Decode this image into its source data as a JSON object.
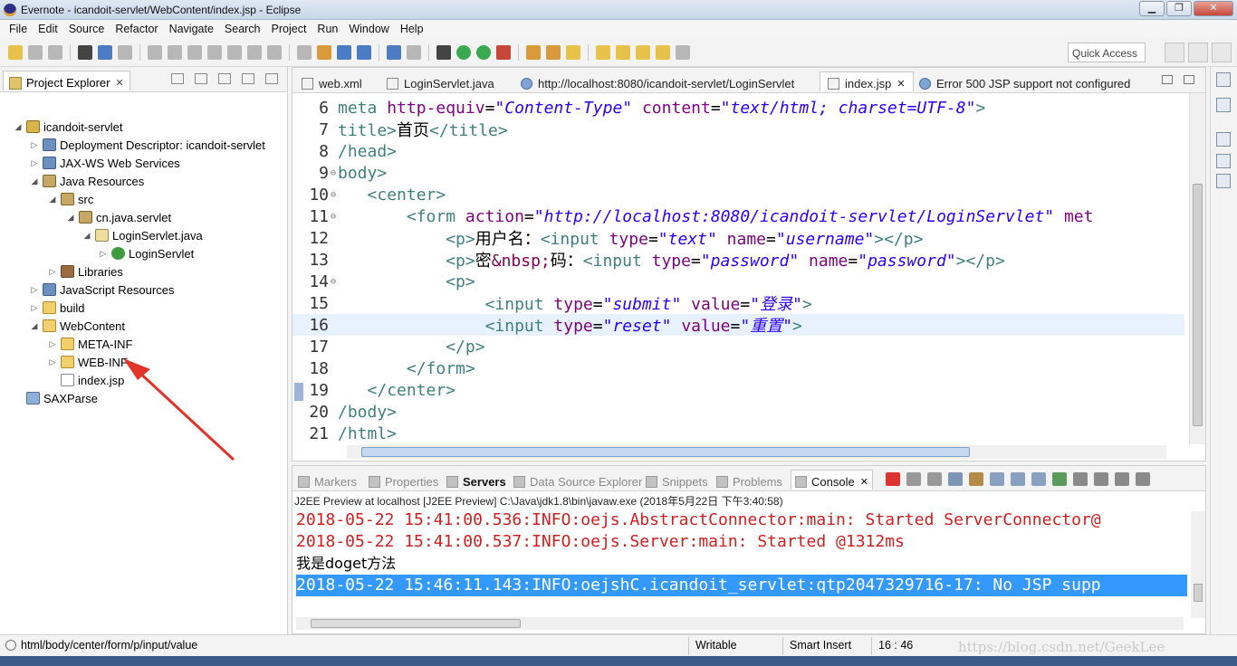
{
  "window": {
    "title": "Evernote - icandoit-servlet/WebContent/index.jsp - Eclipse"
  },
  "menu": [
    "File",
    "Edit",
    "Source",
    "Refactor",
    "Navigate",
    "Search",
    "Project",
    "Run",
    "Window",
    "Help"
  ],
  "toolbar": {
    "quick_access": "Quick Access"
  },
  "explorer": {
    "tab_label": "Project Explorer",
    "close_glyph": "✕",
    "tree": [
      {
        "label": "icandoit-servlet",
        "twisty": "◢",
        "icon": "project-icon"
      },
      {
        "label": "Deployment Descriptor: icandoit-servlet",
        "twisty": "▷",
        "icon": "descriptor-icon"
      },
      {
        "label": "JAX-WS Web Services",
        "twisty": "▷",
        "icon": "webservices-icon"
      },
      {
        "label": "Java Resources",
        "twisty": "◢",
        "icon": "java-resources-icon"
      },
      {
        "label": "src",
        "twisty": "◢",
        "icon": "source-folder-icon"
      },
      {
        "label": "cn.java.servlet",
        "twisty": "◢",
        "icon": "package-icon"
      },
      {
        "label": "LoginServlet.java",
        "twisty": "◢",
        "icon": "java-file-icon"
      },
      {
        "label": "LoginServlet",
        "twisty": "▷",
        "icon": "class-icon"
      },
      {
        "label": "Libraries",
        "twisty": "▷",
        "icon": "libraries-icon"
      },
      {
        "label": "JavaScript Resources",
        "twisty": "▷",
        "icon": "js-resources-icon"
      },
      {
        "label": "build",
        "twisty": "▷",
        "icon": "folder-icon"
      },
      {
        "label": "WebContent",
        "twisty": "◢",
        "icon": "folder-icon"
      },
      {
        "label": "META-INF",
        "twisty": "▷",
        "icon": "folder-icon"
      },
      {
        "label": "WEB-INF",
        "twisty": "▷",
        "icon": "folder-icon"
      },
      {
        "label": "index.jsp",
        "twisty": "",
        "icon": "jsp-file-icon"
      },
      {
        "label": "SAXParse",
        "twisty": "",
        "icon": "project-icon"
      }
    ]
  },
  "editor": {
    "tabs": [
      {
        "label": "web.xml",
        "icon": "xml-icon",
        "active": false
      },
      {
        "label": "LoginServlet.java",
        "icon": "java-icon",
        "active": false
      },
      {
        "label": "http://localhost:8080/icandoit-servlet/LoginServlet",
        "icon": "globe-icon",
        "active": false
      },
      {
        "label": "index.jsp",
        "icon": "jsp-icon",
        "active": true,
        "close": "✕"
      },
      {
        "label": "Error 500 JSP support not configured",
        "icon": "globe-icon",
        "active": false
      }
    ],
    "lines": [
      {
        "n": "6",
        "fold": "",
        "tokens": [
          [
            "tag",
            "meta "
          ],
          [
            "attr",
            "http-equiv"
          ],
          [
            "plain",
            "="
          ],
          [
            "val",
            "\"Content-Type\""
          ],
          [
            "plain",
            " "
          ],
          [
            "attr",
            "content"
          ],
          [
            "plain",
            "="
          ],
          [
            "val",
            "\"text/html; charset=UTF-8\""
          ],
          [
            "tag",
            ">"
          ]
        ]
      },
      {
        "n": "7",
        "fold": "",
        "tokens": [
          [
            "tag",
            "title>"
          ],
          [
            "plain",
            "首页"
          ],
          [
            "tag",
            "</title>"
          ]
        ]
      },
      {
        "n": "8",
        "fold": "",
        "tokens": [
          [
            "tag",
            "/head>"
          ]
        ]
      },
      {
        "n": "9",
        "fold": "⊖",
        "tokens": [
          [
            "tag",
            "body>"
          ]
        ]
      },
      {
        "n": "10",
        "fold": "⊖",
        "tokens": [
          [
            "plain",
            "   "
          ],
          [
            "tag",
            "<center>"
          ]
        ]
      },
      {
        "n": "11",
        "fold": "⊖",
        "tokens": [
          [
            "plain",
            "       "
          ],
          [
            "tag",
            "<form "
          ],
          [
            "attr",
            "action"
          ],
          [
            "plain",
            "="
          ],
          [
            "val",
            "\"http://localhost:8080/icandoit-servlet/LoginServlet\""
          ],
          [
            "plain",
            " "
          ],
          [
            "attr",
            "met"
          ]
        ]
      },
      {
        "n": "12",
        "fold": "",
        "tokens": [
          [
            "plain",
            "           "
          ],
          [
            "tag",
            "<p>"
          ],
          [
            "plain",
            "用户名："
          ],
          [
            "tag",
            "<input "
          ],
          [
            "attr",
            "type"
          ],
          [
            "plain",
            "="
          ],
          [
            "val",
            "\"text\""
          ],
          [
            "plain",
            " "
          ],
          [
            "attr",
            "name"
          ],
          [
            "plain",
            "="
          ],
          [
            "val",
            "\"username\""
          ],
          [
            "tag",
            "></p>"
          ]
        ]
      },
      {
        "n": "13",
        "fold": "",
        "tokens": [
          [
            "plain",
            "           "
          ],
          [
            "tag",
            "<p>"
          ],
          [
            "plain",
            "密"
          ],
          [
            "ent",
            "&nbsp;"
          ],
          [
            "plain",
            "码："
          ],
          [
            "tag",
            "<input "
          ],
          [
            "attr",
            "type"
          ],
          [
            "plain",
            "="
          ],
          [
            "val",
            "\"password\""
          ],
          [
            "plain",
            " "
          ],
          [
            "attr",
            "name"
          ],
          [
            "plain",
            "="
          ],
          [
            "val",
            "\"password\""
          ],
          [
            "tag",
            "></p>"
          ]
        ]
      },
      {
        "n": "14",
        "fold": "⊖",
        "tokens": [
          [
            "plain",
            "           "
          ],
          [
            "tag",
            "<p>"
          ]
        ]
      },
      {
        "n": "15",
        "fold": "",
        "tokens": [
          [
            "plain",
            "               "
          ],
          [
            "tag",
            "<input "
          ],
          [
            "attr",
            "type"
          ],
          [
            "plain",
            "="
          ],
          [
            "val",
            "\"submit\""
          ],
          [
            "plain",
            " "
          ],
          [
            "attr",
            "value"
          ],
          [
            "plain",
            "="
          ],
          [
            "val",
            "\"登录\""
          ],
          [
            "tag",
            ">"
          ]
        ]
      },
      {
        "n": "16",
        "fold": "",
        "current": true,
        "tokens": [
          [
            "plain",
            "               "
          ],
          [
            "tag",
            "<input "
          ],
          [
            "attr",
            "type"
          ],
          [
            "plain",
            "="
          ],
          [
            "val",
            "\"reset\""
          ],
          [
            "plain",
            " "
          ],
          [
            "attr",
            "value"
          ],
          [
            "plain",
            "="
          ],
          [
            "val",
            "\"重置\""
          ],
          [
            "tag",
            ">"
          ]
        ]
      },
      {
        "n": "17",
        "fold": "",
        "tokens": [
          [
            "plain",
            "           "
          ],
          [
            "tag",
            "</p>"
          ]
        ]
      },
      {
        "n": "18",
        "fold": "",
        "tokens": [
          [
            "plain",
            "       "
          ],
          [
            "tag",
            "</form>"
          ]
        ]
      },
      {
        "n": "19",
        "fold": "",
        "tokens": [
          [
            "plain",
            "   "
          ],
          [
            "tag",
            "</center>"
          ]
        ]
      },
      {
        "n": "20",
        "fold": "",
        "tokens": [
          [
            "tag",
            "/body>"
          ]
        ]
      },
      {
        "n": "21",
        "fold": "",
        "tokens": [
          [
            "tag",
            "/html>"
          ]
        ]
      }
    ]
  },
  "console": {
    "tabs": [
      {
        "label": "Markers",
        "icon": "markers-icon"
      },
      {
        "label": "Properties",
        "icon": "properties-icon"
      },
      {
        "label": "Servers",
        "icon": "servers-icon",
        "bold": true
      },
      {
        "label": "Data Source Explorer",
        "icon": "datasource-icon"
      },
      {
        "label": "Snippets",
        "icon": "snippets-icon"
      },
      {
        "label": "Problems",
        "icon": "problems-icon"
      },
      {
        "label": "Console",
        "icon": "console-icon",
        "active": true,
        "close": "✕"
      }
    ],
    "description": "J2EE Preview at localhost [J2EE Preview] C:\\Java\\jdk1.8\\bin\\javaw.exe (2018年5月22日 下午3:40:58)",
    "output": [
      {
        "text": "2018-05-22 15:41:00.536:INFO:oejs.AbstractConnector:main: Started ServerConnector@",
        "style": "red"
      },
      {
        "text": "2018-05-22 15:41:00.537:INFO:oejs.Server:main: Started @1312ms",
        "style": "red"
      },
      {
        "text": "我是doget方法",
        "style": "blk"
      },
      {
        "text": "2018-05-22 15:46:11.143:INFO:oejshC.icandoit_servlet:qtp2047329716-17: No JSP supp",
        "style": "sel"
      }
    ]
  },
  "status": {
    "path": "html/body/center/form/p/input/value",
    "writable": "Writable",
    "insert_mode": "Smart Insert",
    "position": "16 : 46"
  },
  "watermark": "https://blog.csdn.net/GeekLee",
  "colors": {
    "arrow": "#e2332b",
    "selection": "#3399ff",
    "console_error": "#d21e1e",
    "current_line": "#e8f2fe"
  }
}
